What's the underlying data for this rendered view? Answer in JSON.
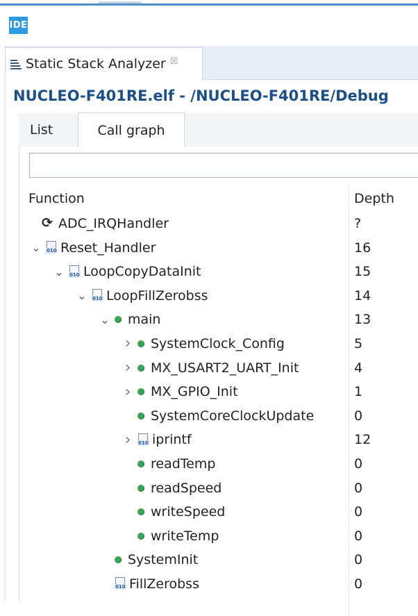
{
  "ide_badge": "IDE",
  "view_tab": {
    "label": "Static Stack Analyzer",
    "close_glyph": "☒"
  },
  "title": "NUCLEO-F401RE.elf - /NUCLEO-F401RE/Debug",
  "subtabs": {
    "list": "List",
    "call_graph": "Call graph"
  },
  "filter": {
    "value": ""
  },
  "columns": {
    "function": "Function",
    "depth": "Depth"
  },
  "rows": [
    {
      "name": "ADC_IRQHandler",
      "depth": "?",
      "level": 0,
      "twisty": "none",
      "icon": "cycle-icon"
    },
    {
      "name": "Reset_Handler",
      "depth": "16",
      "level": 0,
      "twisty": "expanded",
      "icon": "binary-icon"
    },
    {
      "name": "LoopCopyDataInit",
      "depth": "15",
      "level": 1,
      "twisty": "expanded",
      "icon": "binary-icon"
    },
    {
      "name": "LoopFillZerobss",
      "depth": "14",
      "level": 2,
      "twisty": "expanded",
      "icon": "binary-icon"
    },
    {
      "name": "main",
      "depth": "13",
      "level": 3,
      "twisty": "expanded",
      "icon": "function-icon"
    },
    {
      "name": "SystemClock_Config",
      "depth": "5",
      "level": 4,
      "twisty": "collapsed",
      "icon": "function-icon"
    },
    {
      "name": "MX_USART2_UART_Init",
      "depth": "4",
      "level": 4,
      "twisty": "collapsed",
      "icon": "function-icon"
    },
    {
      "name": "MX_GPIO_Init",
      "depth": "1",
      "level": 4,
      "twisty": "collapsed",
      "icon": "function-icon"
    },
    {
      "name": "SystemCoreClockUpdate",
      "depth": "0",
      "level": 4,
      "twisty": "none",
      "icon": "function-icon"
    },
    {
      "name": "iprintf",
      "depth": "12",
      "level": 4,
      "twisty": "collapsed",
      "icon": "binary-icon"
    },
    {
      "name": "readTemp",
      "depth": "0",
      "level": 4,
      "twisty": "none",
      "icon": "function-icon"
    },
    {
      "name": "readSpeed",
      "depth": "0",
      "level": 4,
      "twisty": "none",
      "icon": "function-icon"
    },
    {
      "name": "writeSpeed",
      "depth": "0",
      "level": 4,
      "twisty": "none",
      "icon": "function-icon"
    },
    {
      "name": "writeTemp",
      "depth": "0",
      "level": 4,
      "twisty": "none",
      "icon": "function-icon"
    },
    {
      "name": "SystemInit",
      "depth": "0",
      "level": 3,
      "twisty": "none",
      "icon": "function-icon"
    },
    {
      "name": "FillZerobss",
      "depth": "0",
      "level": 3,
      "twisty": "none",
      "icon": "binary-icon"
    }
  ],
  "colors": {
    "accent": "#2e9be0",
    "title": "#1b4f8a",
    "function_dot": "#3aa655"
  }
}
